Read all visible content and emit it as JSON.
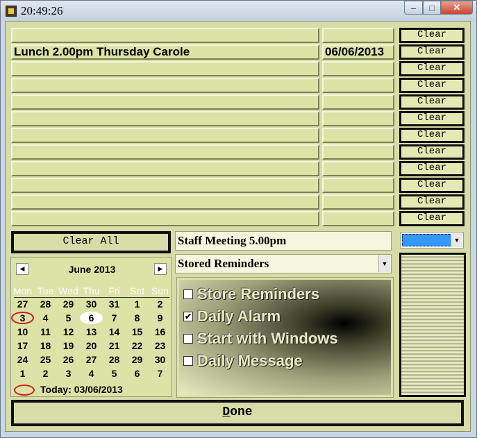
{
  "window": {
    "title": "20:49:26",
    "minimize_glyph": "–",
    "maximize_glyph": "□",
    "close_glyph": "✕"
  },
  "reminders": [
    {
      "text": "",
      "date": ""
    },
    {
      "text": "Lunch 2.00pm Thursday Carole",
      "date": "06/06/2013"
    },
    {
      "text": "",
      "date": ""
    },
    {
      "text": "",
      "date": ""
    },
    {
      "text": "",
      "date": ""
    },
    {
      "text": "",
      "date": ""
    },
    {
      "text": "",
      "date": ""
    },
    {
      "text": "",
      "date": ""
    },
    {
      "text": "",
      "date": ""
    },
    {
      "text": "",
      "date": ""
    },
    {
      "text": "",
      "date": ""
    },
    {
      "text": "",
      "date": ""
    }
  ],
  "clear_label": "Clear",
  "clear_all_label": "Clear All",
  "reminder_input": {
    "value": "Staff Meeting 5.00pm"
  },
  "stored_select": {
    "value": "Stored Reminders",
    "arrow": "▼"
  },
  "options": [
    {
      "label": "Store Reminders",
      "checked": false
    },
    {
      "label": "Daily Alarm",
      "checked": true
    },
    {
      "label": "Start with Windows",
      "checked": false
    },
    {
      "label": "Daily Message",
      "checked": false
    }
  ],
  "color_select": {
    "value_color": "#3399ff",
    "arrow": "▼"
  },
  "calendar": {
    "month": "June 2013",
    "prev_glyph": "◀",
    "next_glyph": "▶",
    "weekdays": [
      "Mon",
      "Tue",
      "Wed",
      "Thu",
      "Fri",
      "Sat",
      "Sun"
    ],
    "weeks": [
      [
        "27",
        "28",
        "29",
        "30",
        "31",
        "1",
        "2"
      ],
      [
        "3",
        "4",
        "5",
        "6",
        "7",
        "8",
        "9"
      ],
      [
        "10",
        "11",
        "12",
        "13",
        "14",
        "15",
        "16"
      ],
      [
        "17",
        "18",
        "19",
        "20",
        "21",
        "22",
        "23"
      ],
      [
        "24",
        "25",
        "26",
        "27",
        "28",
        "29",
        "30"
      ],
      [
        "1",
        "2",
        "3",
        "4",
        "5",
        "6",
        "7"
      ]
    ],
    "today_cell": [
      1,
      0
    ],
    "selected_cell": [
      1,
      3
    ],
    "today_label": "Today: 03/06/2013"
  },
  "done": {
    "label": "Done",
    "hotkey": "D",
    "rest": "one"
  },
  "colors": {
    "panel": "#d7dca8",
    "cell": "#dde3a6",
    "border_dark": "#101010",
    "highlight": "#3399ff",
    "today_ring": "#cc2020"
  }
}
